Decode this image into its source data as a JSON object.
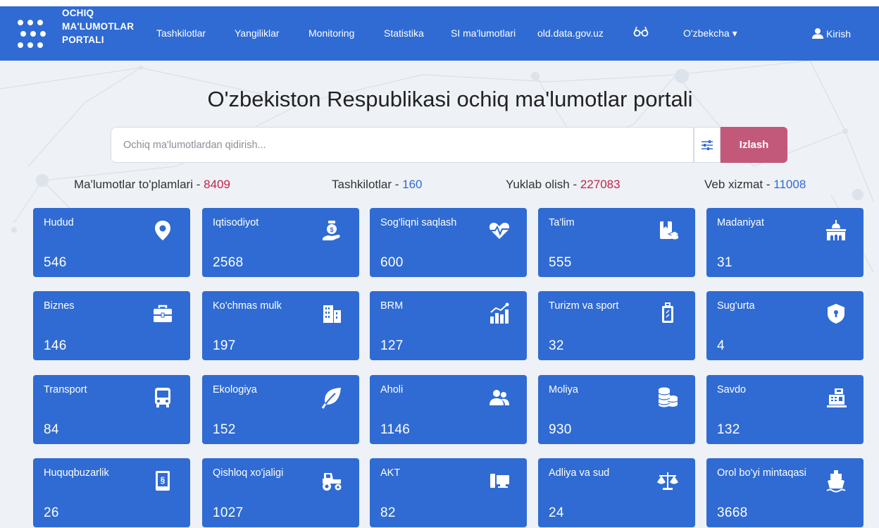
{
  "header": {
    "logo_lines": [
      "OCHIQ",
      "MA'LUMOTLAR",
      "PORTALI"
    ],
    "nav": [
      "Tashkilotlar",
      "Yangiliklar",
      "Monitoring",
      "Statistika",
      "SI ma'lumotlari",
      "old.data.gov.uz"
    ],
    "glasses_icon": "glasses-icon",
    "language": "O'zbekcha ▾",
    "login": "Kirish"
  },
  "hero": {
    "title": "O'zbekiston Respublikasi ochiq ma'lumotlar portali",
    "search_placeholder": "Ochiq ma'lumotlardan qidirish...",
    "search_button": "Izlash"
  },
  "stats": [
    {
      "label": "Ma'lumotlar to'plamlari - ",
      "value": "8409",
      "color": "#c0244a"
    },
    {
      "label": "Tashkilotlar - ",
      "value": "160",
      "color": "#2f6bd3"
    },
    {
      "label": "Yuklab olish - ",
      "value": "227083",
      "color": "#c0244a"
    },
    {
      "label": "Veb xizmat - ",
      "value": "11008",
      "color": "#2f6bd3"
    }
  ],
  "categories": [
    {
      "name": "Hudud",
      "count": "546",
      "icon": "map-marker-icon"
    },
    {
      "name": "Iqtisodiyot",
      "count": "2568",
      "icon": "money-hand-icon"
    },
    {
      "name": "Sog'liqni saqlash",
      "count": "600",
      "icon": "heartbeat-icon"
    },
    {
      "name": "Ta'lim",
      "count": "555",
      "icon": "education-book-icon"
    },
    {
      "name": "Madaniyat",
      "count": "31",
      "icon": "mosque-icon"
    },
    {
      "name": "Biznes",
      "count": "146",
      "icon": "briefcase-icon"
    },
    {
      "name": "Ko'chmas mulk",
      "count": "197",
      "icon": "buildings-icon"
    },
    {
      "name": "BRM",
      "count": "127",
      "icon": "growth-chart-icon"
    },
    {
      "name": "Turizm va sport",
      "count": "32",
      "icon": "luggage-icon"
    },
    {
      "name": "Sug'urta",
      "count": "4",
      "icon": "shield-lock-icon"
    },
    {
      "name": "Transport",
      "count": "84",
      "icon": "bus-icon"
    },
    {
      "name": "Ekologiya",
      "count": "152",
      "icon": "leaf-icon"
    },
    {
      "name": "Aholi",
      "count": "1146",
      "icon": "users-icon"
    },
    {
      "name": "Moliya",
      "count": "930",
      "icon": "coins-icon"
    },
    {
      "name": "Savdo",
      "count": "132",
      "icon": "cash-register-icon"
    },
    {
      "name": "Huquqbuzarlik",
      "count": "26",
      "icon": "law-book-icon"
    },
    {
      "name": "Qishloq xo'jaligi",
      "count": "1027",
      "icon": "tractor-icon"
    },
    {
      "name": "AKT",
      "count": "82",
      "icon": "computer-icon"
    },
    {
      "name": "Adliya va sud",
      "count": "24",
      "icon": "balance-scale-icon"
    },
    {
      "name": "Orol bo'yi mintaqasi",
      "count": "3668",
      "icon": "ship-icon"
    }
  ]
}
